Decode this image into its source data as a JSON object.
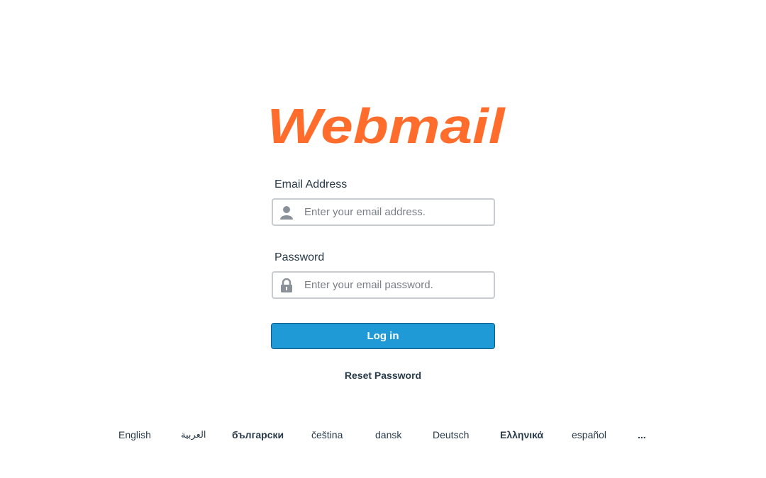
{
  "logo": {
    "text": "Webmail",
    "color": "#ff6c2c"
  },
  "email": {
    "label": "Email Address",
    "placeholder": "Enter your email address.",
    "value": "",
    "icon": "user-icon"
  },
  "password": {
    "label": "Password",
    "placeholder": "Enter your email password.",
    "value": "",
    "icon": "lock-icon"
  },
  "login_button": {
    "label": "Log in",
    "color": "#1f9ad6"
  },
  "reset_link": {
    "label": "Reset Password"
  },
  "languages": [
    {
      "label": "English"
    },
    {
      "label": "العربية"
    },
    {
      "label": "български"
    },
    {
      "label": "čeština"
    },
    {
      "label": "dansk"
    },
    {
      "label": "Deutsch"
    },
    {
      "label": "Ελληνικά"
    },
    {
      "label": "español"
    },
    {
      "label": "..."
    }
  ]
}
